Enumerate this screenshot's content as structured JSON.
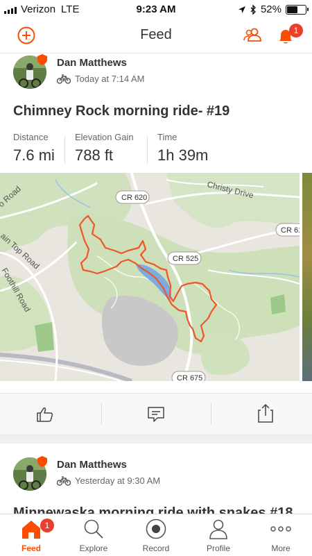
{
  "status_bar": {
    "carrier": "Verizon",
    "network": "LTE",
    "time": "9:23 AM",
    "battery": "52%"
  },
  "header": {
    "title": "Feed",
    "notification_count": "1"
  },
  "colors": {
    "accent": "#fc4c02",
    "badge": "#e8402a",
    "route": "#f0552a"
  },
  "activities": [
    {
      "athlete": "Dan Matthews",
      "timestamp": "Today at 7:14 AM",
      "title": "Chimney Rock morning ride- #19",
      "stats": [
        {
          "label": "Distance",
          "value": "7.6 mi"
        },
        {
          "label": "Elevation Gain",
          "value": "788 ft"
        },
        {
          "label": "Time",
          "value": "1h 39m"
        }
      ],
      "map_labels": {
        "road1": "Christy Drive",
        "road2": "CR 620",
        "road3": "CR 61",
        "road4": "CR 525",
        "road5": "CR 675",
        "road6": "o Road",
        "road7": "ain Top Road",
        "road8": "Foothill Road"
      }
    },
    {
      "athlete": "Dan Matthews",
      "timestamp": "Yesterday at 9:30 AM",
      "title": "Minnewaska morning ride with snakes #18"
    }
  ],
  "actions": {
    "like_icon": "thumbs-up-icon",
    "comment_icon": "comment-icon",
    "share_icon": "share-icon"
  },
  "tabs": [
    {
      "label": "Feed",
      "icon": "home-icon",
      "badge": "1"
    },
    {
      "label": "Explore",
      "icon": "search-icon"
    },
    {
      "label": "Record",
      "icon": "record-icon"
    },
    {
      "label": "Profile",
      "icon": "profile-icon"
    },
    {
      "label": "More",
      "icon": "more-icon"
    }
  ]
}
